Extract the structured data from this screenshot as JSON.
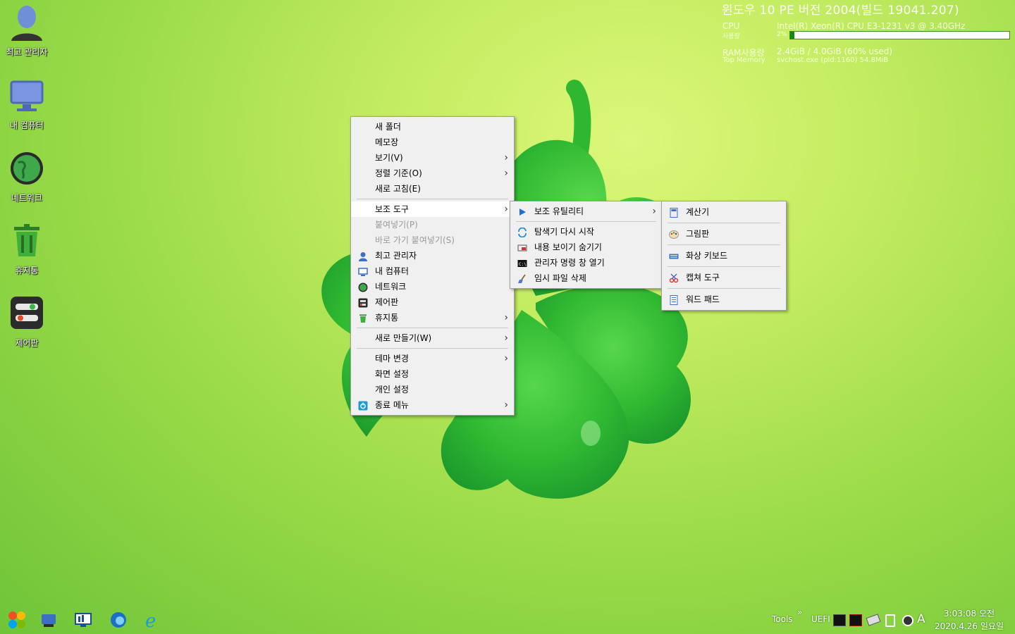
{
  "desktop": {
    "icons": [
      {
        "label": "최고 관리자",
        "icon": "user-icon"
      },
      {
        "label": "내 컴퓨터",
        "icon": "monitor-icon"
      },
      {
        "label": "네트워크",
        "icon": "globe-icon"
      },
      {
        "label": "휴지통",
        "icon": "trash-icon"
      },
      {
        "label": "제어판",
        "icon": "control-panel-icon"
      }
    ]
  },
  "sysinfo": {
    "title": "윈도우 10 PE   버전 2004(빌드 19041.207)",
    "cpu_label": "CPU",
    "cpu_value": "Intel(R) Xeon(R) CPU E3-1231 v3 @ 3.40GHz",
    "usage_label": "사용량",
    "usage_value": "2%",
    "usage_fraction": 0.02,
    "ram_label": "RAM사용량",
    "ram_value": "2.4GiB / 4.0GiB (60% used)",
    "topmem_label": "Top Memory",
    "topmem_value": "svchost.exe (pid:1160) 54.8MiB"
  },
  "context_menu": {
    "items": [
      {
        "label": "새 폴더"
      },
      {
        "label": "메모장"
      },
      {
        "label": "보기(V)",
        "submenu": true
      },
      {
        "label": "정렬 기준(O)",
        "submenu": true
      },
      {
        "label": "새로 고침(E)"
      },
      {
        "separator": true
      },
      {
        "label": "보조 도구",
        "submenu": true,
        "active": true
      },
      {
        "label": "붙여넣기(P)",
        "disabled": true
      },
      {
        "label": "바로 가기 붙여넣기(S)",
        "disabled": true
      },
      {
        "label": "최고 관리자",
        "icon": "user-icon"
      },
      {
        "label": "내 컴퓨터",
        "icon": "monitor-icon"
      },
      {
        "label": "네트워크",
        "icon": "globe-icon"
      },
      {
        "label": "제어판",
        "icon": "control-panel-icon"
      },
      {
        "label": "휴지통",
        "icon": "trash-icon",
        "submenu": true
      },
      {
        "separator": true
      },
      {
        "label": "새로 만들기(W)",
        "submenu": true
      },
      {
        "separator": true
      },
      {
        "label": "테마 변경",
        "submenu": true
      },
      {
        "label": "화면 설정"
      },
      {
        "label": "개인 설정"
      },
      {
        "label": "종료 메뉴",
        "icon": "power-icon",
        "submenu": true
      }
    ]
  },
  "submenu_tools": {
    "items": [
      {
        "label": "보조 유틸리티",
        "icon": "play-icon",
        "submenu": true
      },
      {
        "separator": true
      },
      {
        "label": "탐색기 다시 시작",
        "icon": "refresh-icon"
      },
      {
        "label": "내용 보이기 숨기기",
        "icon": "show-hide-icon"
      },
      {
        "label": "관리자 명령 창 열기",
        "icon": "cmd-icon"
      },
      {
        "label": "임시 파일 삭제",
        "icon": "broom-icon"
      }
    ]
  },
  "submenu_utilities": {
    "items": [
      {
        "label": "계산기",
        "icon": "calculator-icon"
      },
      {
        "separator": true
      },
      {
        "label": "그림판",
        "icon": "paint-icon"
      },
      {
        "separator": true
      },
      {
        "label": "화상 키보드",
        "icon": "keyboard-icon"
      },
      {
        "separator": true
      },
      {
        "label": "캡쳐 도구",
        "icon": "snipping-icon"
      },
      {
        "separator": true
      },
      {
        "label": "워드 패드",
        "icon": "wordpad-icon"
      }
    ]
  },
  "taskbar": {
    "apps": [
      {
        "icon": "start-icon"
      },
      {
        "icon": "explorer-icon"
      },
      {
        "icon": "remote-desktop-icon"
      },
      {
        "icon": "edge-icon"
      },
      {
        "icon": "internet-explorer-icon"
      }
    ],
    "tools_label": "Tools",
    "overflow": "»",
    "uefi_label": "UEFI",
    "ime_label": "A",
    "time": "3:03:08 오전",
    "date": "2020.4.26 일요일"
  }
}
